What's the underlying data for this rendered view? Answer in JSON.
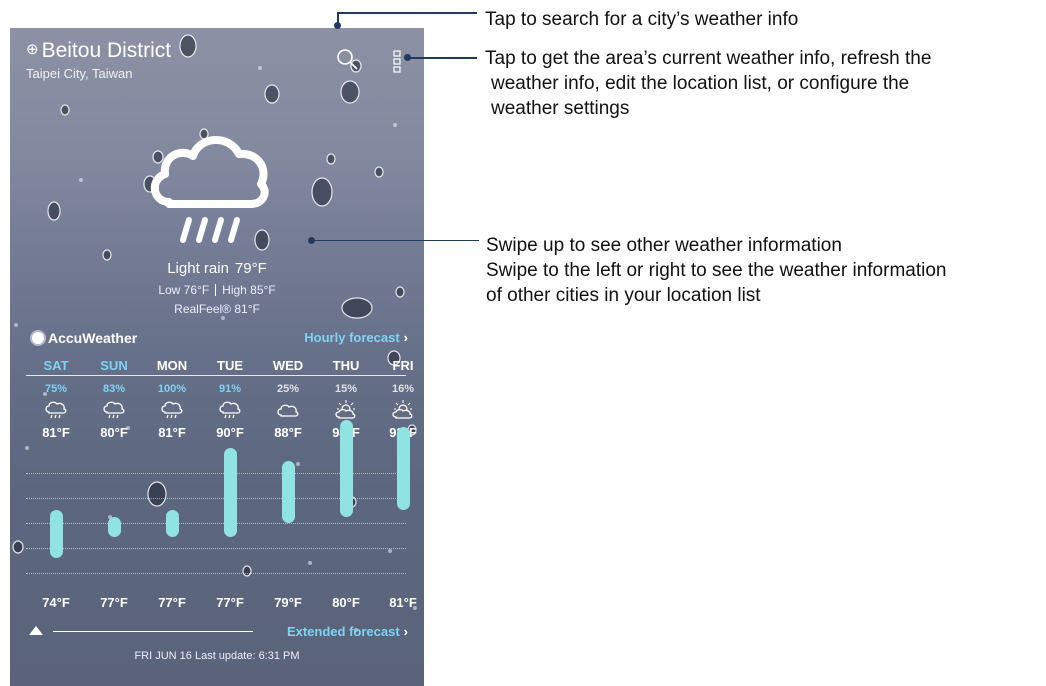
{
  "header": {
    "location": "Beitou District",
    "location_icon": "location-target-icon",
    "sublocation": "Taipei City, Taiwan"
  },
  "toolbar": {
    "search_icon": "search-icon",
    "menu_icon": "more-vert-icon"
  },
  "current": {
    "icon": "rain-cloud-icon",
    "condition": "Light rain",
    "temp": "79°F",
    "low": "Low 76°F",
    "high": "High 85°F",
    "realfeel": "RealFeel® 81°F"
  },
  "provider": {
    "name": "AccuWeather",
    "hourly_link": "Hourly forecast"
  },
  "forecast": {
    "days": [
      {
        "day": "SAT",
        "pct": "75%",
        "high": "81°F",
        "low": "74°F",
        "icon": "rain-icon",
        "accent": true
      },
      {
        "day": "SUN",
        "pct": "83%",
        "high": "80°F",
        "low": "77°F",
        "icon": "rain-icon",
        "accent": true
      },
      {
        "day": "MON",
        "pct": "100%",
        "high": "81°F",
        "low": "77°F",
        "icon": "rain-icon",
        "accent": false
      },
      {
        "day": "TUE",
        "pct": "91%",
        "high": "90°F",
        "low": "77°F",
        "icon": "rain-icon",
        "accent": false
      },
      {
        "day": "WED",
        "pct": "25%",
        "high": "88°F",
        "low": "79°F",
        "icon": "cloudy-icon",
        "accent": false
      },
      {
        "day": "THU",
        "pct": "15%",
        "high": "94°F",
        "low": "80°F",
        "icon": "partly-sunny-icon",
        "accent": false
      },
      {
        "day": "FRI",
        "pct": "16%",
        "high": "93°F",
        "low": "81°F",
        "icon": "partly-sunny-icon",
        "accent": false
      }
    ],
    "temp_bars": [
      {
        "low": 74,
        "high": 81
      },
      {
        "low": 77,
        "high": 80
      },
      {
        "low": 77,
        "high": 81
      },
      {
        "low": 77,
        "high": 90
      },
      {
        "low": 79,
        "high": 88
      },
      {
        "low": 80,
        "high": 94
      },
      {
        "low": 81,
        "high": 93
      }
    ]
  },
  "footer": {
    "extended_link": "Extended forecast",
    "update": "FRI JUN 16 Last update: 6:31 PM"
  },
  "callouts": {
    "search": "Tap to search for a city’s weather info",
    "menu_lines": [
      "Tap to get the area’s current weather info, refresh the",
      "weather info, edit the location list, or configure the",
      "weather settings"
    ],
    "swipe_lines": [
      "Swipe up to see other weather information",
      "Swipe to the left or right to see the weather information",
      "of other cities in your location list"
    ]
  },
  "colors": {
    "accent_blue": "#7fd3f4",
    "bar": "#8fe3e3",
    "callout_line": "#1f3a5e"
  }
}
